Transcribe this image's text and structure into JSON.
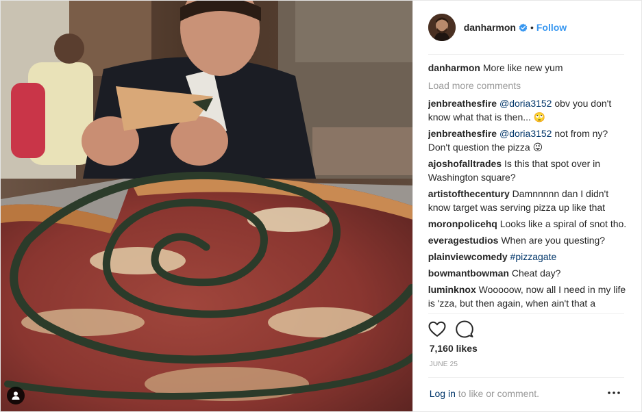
{
  "post": {
    "username": "danharmon",
    "follow_label": "Follow",
    "separator_dot": "•",
    "caption": {
      "author": "danharmon",
      "text": "More like new yum"
    },
    "load_more": "Load more comments",
    "comments": [
      {
        "author": "jenbreathesfire",
        "mention": "@doria3152",
        "text": " obv you don't know what that is then... 🙄"
      },
      {
        "author": "jenbreathesfire",
        "mention": "@doria3152",
        "text": " not from ny? Don't question the pizza 😜"
      },
      {
        "author": "ajoshofalltrades",
        "mention": "",
        "text": "Is this that spot over in Washington square?"
      },
      {
        "author": "artistofthecentury",
        "mention": "",
        "text": "Damnnnnn dan I didn't know target was serving pizza up like that"
      },
      {
        "author": "moronpolicehq",
        "mention": "",
        "text": "Looks like a spiral of snot tho."
      },
      {
        "author": "everagestudios",
        "mention": "",
        "text": "When are you questing?"
      },
      {
        "author": "plainviewcomedy",
        "mention": "#pizzagate",
        "text": ""
      },
      {
        "author": "bowmantbowman",
        "mention": "",
        "text": "Cheat day?"
      },
      {
        "author": "luminknox",
        "mention": "",
        "text": "Wooooow, now all I need in my life is 'zza, but then again, when ain't that a"
      }
    ],
    "likes": "7,160 likes",
    "date": "JUNE 25",
    "footer": {
      "login": "Log in",
      "rest": " to like or comment."
    },
    "more_glyph": "•••"
  },
  "icons": {
    "verified": "verified-badge-icon",
    "like": "heart-icon",
    "comment": "comment-bubble-icon",
    "user_tag": "user-tag-icon",
    "more": "more-options-icon"
  },
  "colors": {
    "accent": "#3897f0",
    "link": "#003569",
    "muted": "#999999",
    "text": "#262626"
  }
}
